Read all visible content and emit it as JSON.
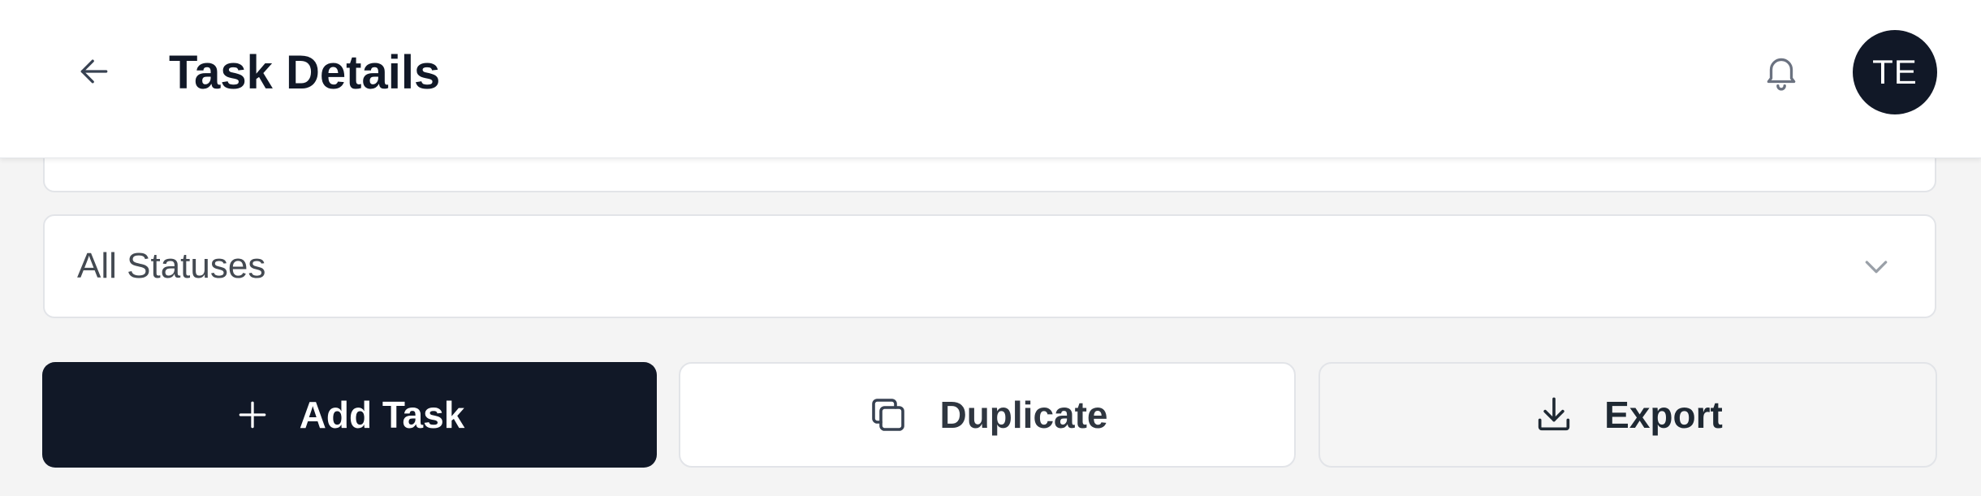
{
  "header": {
    "title": "Task Details",
    "back_icon": "arrow-left-icon",
    "notification_icon": "bell-icon",
    "avatar_initials": "TE"
  },
  "filters": {
    "status_select": {
      "value": "All Statuses",
      "icon": "chevron-down-icon"
    }
  },
  "actions": {
    "add": {
      "label": "Add Task",
      "icon": "plus-icon"
    },
    "duplicate": {
      "label": "Duplicate",
      "icon": "copy-icon"
    },
    "export": {
      "label": "Export",
      "icon": "download-icon"
    }
  },
  "colors": {
    "primary": "#111827",
    "background": "#f4f4f4",
    "surface": "#ffffff",
    "border": "#e2e4e8"
  }
}
